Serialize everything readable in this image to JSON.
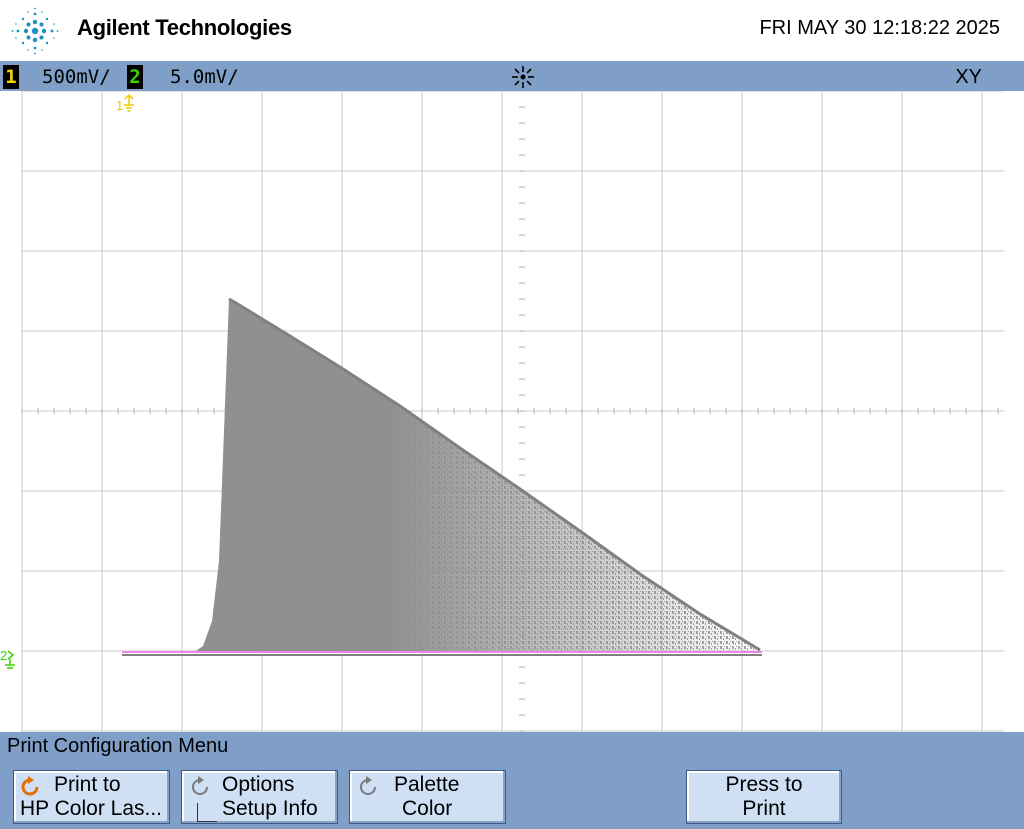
{
  "header": {
    "brand": "Agilent Technologies",
    "datetime": "FRI MAY 30 12:18:22 2025"
  },
  "status": {
    "ch1": {
      "label": "1",
      "scale": "500mV/",
      "color": "#f2d200"
    },
    "ch2": {
      "label": "2",
      "scale": "5.0mV/",
      "color": "#39d400"
    },
    "run_icon": "acquisition-run-icon",
    "mode": "XY"
  },
  "markers": {
    "ch1_ground": "1",
    "ch2_ground": "2"
  },
  "colors": {
    "trace_gray": "#909090",
    "trace_pink": "#ee82ee",
    "menu_bg": "#7f9fc9",
    "key_bg": "#cfe0f5"
  },
  "menu": {
    "title": "Print Configuration Menu",
    "keys": [
      {
        "line1": "Print to",
        "line2": "HP Color Las...",
        "icon": "refresh-orange-icon"
      },
      {
        "line1": "Options",
        "line2": "Setup Info",
        "icon": "refresh-gray-icon",
        "checkbox": false
      },
      {
        "line1": "Palette",
        "line2": "Color",
        "icon": "refresh-gray-icon"
      },
      {
        "line1": "Press to",
        "line2": "Print"
      }
    ]
  }
}
